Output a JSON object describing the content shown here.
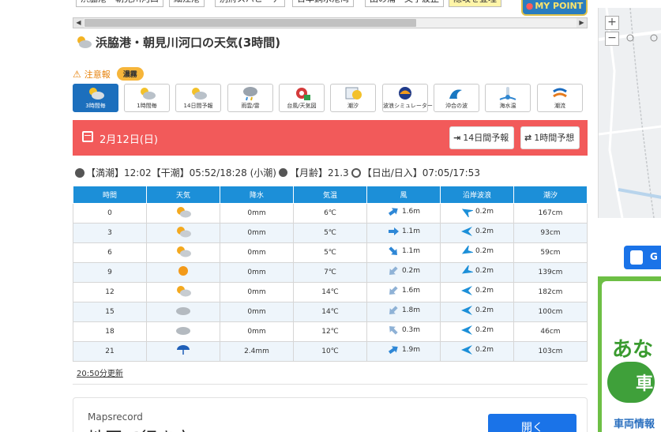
{
  "top_tabs": [
    "浜脇港・朝見川河口",
    "細江港",
    "別府スパビーチ",
    "日本鋼水港湾",
    "田の浦・文字波止",
    "隠岐を登埋"
  ],
  "mypoint_label": "MY POINT",
  "page_title": "浜脇港・朝見川河口の天気(3時間)",
  "warning": {
    "label": "注意報",
    "badge": "濃霧"
  },
  "nav_buttons": [
    {
      "label": "3時間毎",
      "icon": "sun-cloud-icon",
      "active": true
    },
    {
      "label": "1時間毎",
      "icon": "sun-cloud-icon"
    },
    {
      "label": "14日間予報",
      "icon": "sun-cloud-icon"
    },
    {
      "label": "雨雲/雷",
      "icon": "rain-cloud-icon"
    },
    {
      "label": "台風/天気図",
      "icon": "typhoon-icon"
    },
    {
      "label": "潮汐",
      "icon": "tide-chart-icon"
    },
    {
      "label": "波浪シミュレーター",
      "icon": "wave-sim-icon"
    },
    {
      "label": "沖合の波",
      "icon": "wave-icon"
    },
    {
      "label": "海水温",
      "icon": "thermometer-icon"
    },
    {
      "label": "潮流",
      "icon": "current-icon"
    }
  ],
  "date_bar": {
    "date": "2月12日(日)",
    "btn_14day": "14日間予報",
    "btn_1hour": "1時間予想"
  },
  "tide_info": {
    "text1": "【満潮】12:02【干潮】05:52/18:28 (小潮)",
    "text2": "【月齢】21.3",
    "text3": "【日出/日入】07:05/17:53"
  },
  "table": {
    "headers": [
      "時間",
      "天気",
      "降水",
      "気温",
      "風",
      "沿岸波浪",
      "潮汐"
    ],
    "rows": [
      {
        "time": "0",
        "weather": "sun-cloud",
        "precip": "0mm",
        "temp": "6℃",
        "wind": "1.6m",
        "wind_dir": "up-right",
        "wave": "0.2m",
        "wave_dir": "left-up",
        "tide": "167cm"
      },
      {
        "time": "3",
        "weather": "sun-cloud",
        "precip": "0mm",
        "temp": "5℃",
        "wind": "1.1m",
        "wind_dir": "right",
        "wave": "0.2m",
        "wave_dir": "left",
        "tide": "93cm"
      },
      {
        "time": "6",
        "weather": "sun-cloud",
        "precip": "0mm",
        "temp": "5℃",
        "wind": "1.1m",
        "wind_dir": "down-right",
        "wave": "0.2m",
        "wave_dir": "left-down",
        "tide": "59cm"
      },
      {
        "time": "9",
        "weather": "sun",
        "precip": "0mm",
        "temp": "7℃",
        "wind": "0.2m",
        "wind_dir": "down-left",
        "wave": "0.2m",
        "wave_dir": "left-down",
        "tide": "139cm"
      },
      {
        "time": "12",
        "weather": "sun-cloud",
        "precip": "0mm",
        "temp": "14℃",
        "wind": "1.6m",
        "wind_dir": "down-left",
        "wave": "0.2m",
        "wave_dir": "left",
        "tide": "182cm"
      },
      {
        "time": "15",
        "weather": "cloud",
        "precip": "0mm",
        "temp": "14℃",
        "wind": "1.8m",
        "wind_dir": "down-left",
        "wave": "0.2m",
        "wave_dir": "left",
        "tide": "100cm"
      },
      {
        "time": "18",
        "weather": "cloud",
        "precip": "0mm",
        "temp": "12℃",
        "wind": "0.3m",
        "wind_dir": "up-left",
        "wave": "0.2m",
        "wave_dir": "left",
        "tide": "46cm"
      },
      {
        "time": "21",
        "weather": "umbrella",
        "precip": "2.4mm",
        "temp": "10℃",
        "wind": "1.9m",
        "wind_dir": "up-right",
        "wave": "0.2m",
        "wave_dir": "left",
        "tide": "103cm"
      }
    ]
  },
  "updated": "20:50分更新",
  "ad": {
    "brand": "Mapsrecord",
    "headline": "地図で行き方",
    "open": "開く"
  },
  "right_panel": {
    "google_btn": "G",
    "green_big": "あな",
    "green_car": "車",
    "green_small": "車両情報"
  },
  "colors": {
    "accent_blue": "#1c8fd8",
    "date_bar_red": "#f25a5a",
    "badge_orange": "#f6b53a"
  }
}
